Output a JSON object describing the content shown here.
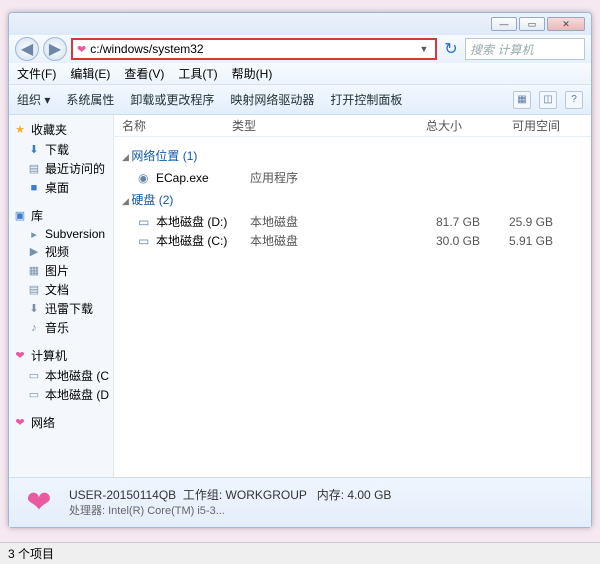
{
  "window": {
    "min": "—",
    "max": "▭",
    "close": "✕"
  },
  "nav": {
    "back": "◀",
    "forward": "▶",
    "address": "c:/windows/system32",
    "refresh": "↻",
    "search_placeholder": "搜索 计算机"
  },
  "menu": {
    "file": "文件(F)",
    "edit": "编辑(E)",
    "view": "查看(V)",
    "tools": "工具(T)",
    "help": "帮助(H)"
  },
  "toolbar": {
    "organize": "组织 ▾",
    "properties": "系统属性",
    "uninstall": "卸载或更改程序",
    "netdrive": "映射网络驱动器",
    "controlpanel": "打开控制面板"
  },
  "columns": {
    "name": "名称",
    "type": "类型",
    "total": "总大小",
    "free": "可用空间"
  },
  "groups": {
    "netloc": "网络位置 (1)",
    "disks": "硬盘 (2)"
  },
  "items": {
    "ecap": {
      "name": "ECap.exe",
      "type": "应用程序"
    },
    "d": {
      "name": "本地磁盘 (D:)",
      "type": "本地磁盘",
      "total": "81.7 GB",
      "free": "25.9 GB"
    },
    "c": {
      "name": "本地磁盘 (C:)",
      "type": "本地磁盘",
      "total": "30.0 GB",
      "free": "5.91 GB"
    }
  },
  "sidebar": {
    "fav": "收藏夹",
    "downloads": "下载",
    "recent": "最近访问的",
    "desktop": "桌面",
    "libraries": "库",
    "subversion": "Subversion",
    "videos": "视频",
    "pictures": "图片",
    "documents": "文档",
    "xunlei": "迅雷下载",
    "music": "音乐",
    "computer": "计算机",
    "diskC": "本地磁盘 (C",
    "diskD": "本地磁盘 (D",
    "network": "网络"
  },
  "details": {
    "name": "USER-20150114QB",
    "workgroup_label": "工作组:",
    "workgroup": "WORKGROUP",
    "mem_label": "内存:",
    "mem": "4.00 GB",
    "cpu_label": "处理器:",
    "cpu": "Intel(R) Core(TM) i5-3..."
  },
  "status": "3 个项目"
}
